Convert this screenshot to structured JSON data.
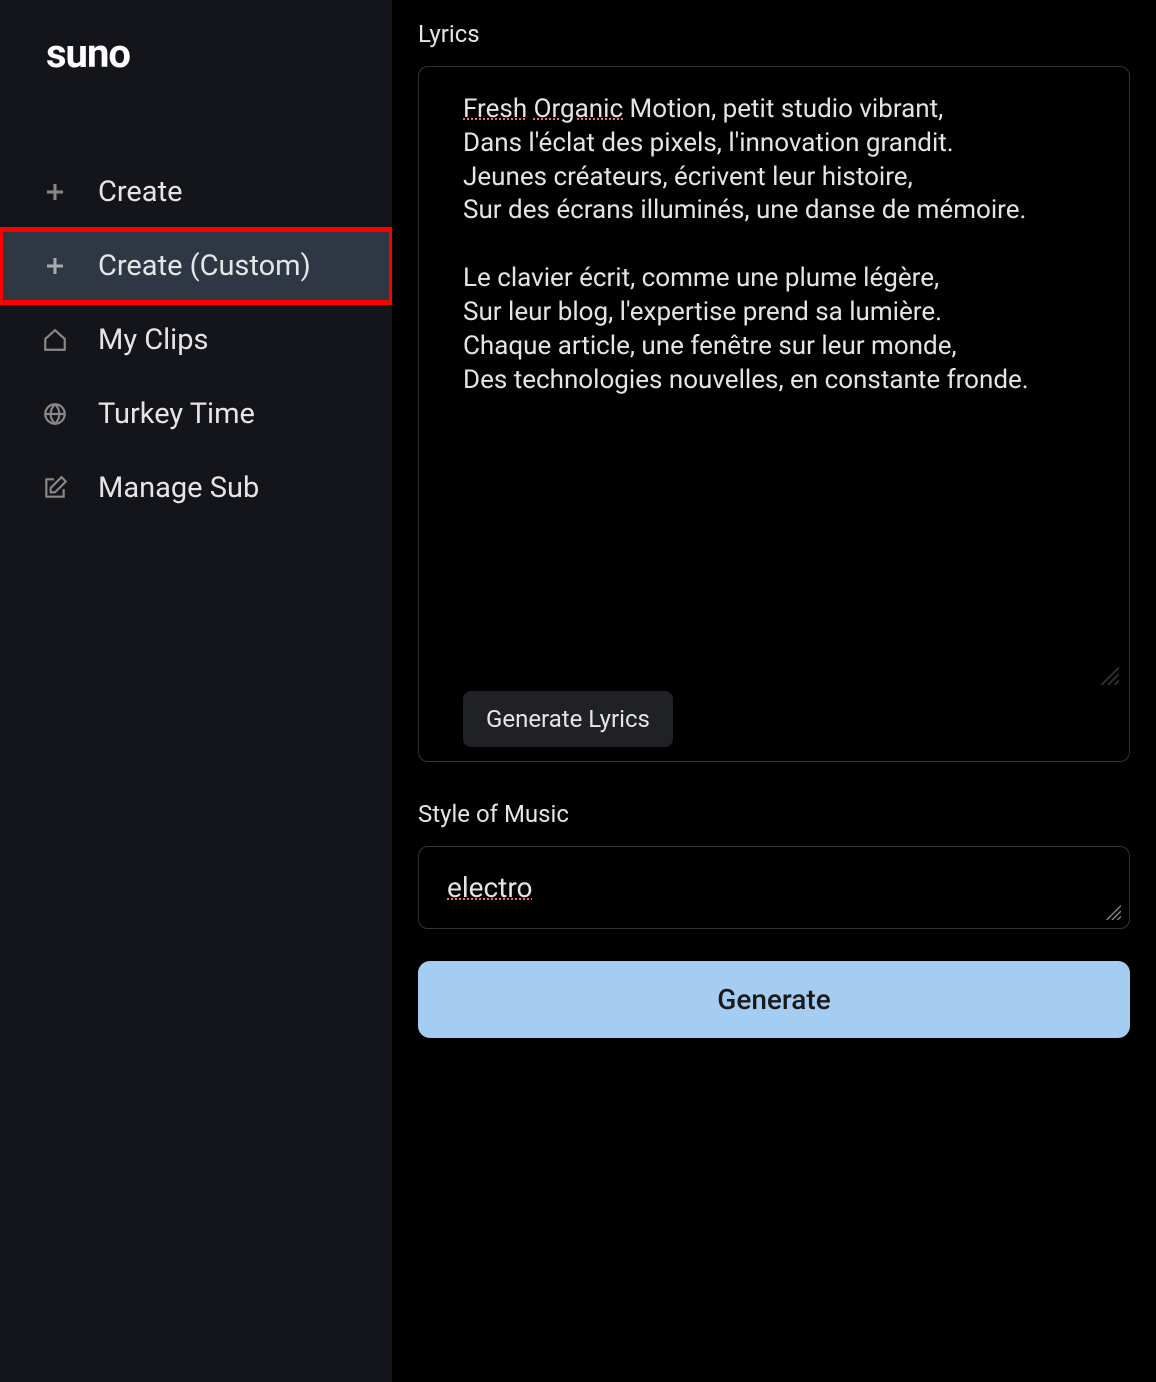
{
  "logo": "suno",
  "sidebar": {
    "items": [
      {
        "label": "Create",
        "icon": "plus",
        "active": false,
        "highlighted": false
      },
      {
        "label": "Create (Custom)",
        "icon": "plus",
        "active": true,
        "highlighted": true
      },
      {
        "label": "My Clips",
        "icon": "home",
        "active": false,
        "highlighted": false
      },
      {
        "label": "Turkey Time",
        "icon": "globe",
        "active": false,
        "highlighted": false
      },
      {
        "label": "Manage Sub",
        "icon": "edit",
        "active": false,
        "highlighted": false
      }
    ]
  },
  "lyrics": {
    "label": "Lyrics",
    "content_para1": "Fresh Organic Motion, petit studio vibrant,\nDans l'éclat des pixels, l'innovation grandit.\nJeunes créateurs, écrivent leur histoire,\nSur des écrans illuminés, une danse de mémoire.",
    "content_para2": "Le clavier écrit, comme une plume légère,\nSur leur blog, l'expertise prend sa lumière.\nChaque article, une fenêtre sur leur monde,\nDes technologies nouvelles, en constante fronde.",
    "spell_words": [
      "Fresh",
      "Organic"
    ],
    "generate_button": "Generate Lyrics"
  },
  "style": {
    "label": "Style of Music",
    "value": "electro",
    "spell": true
  },
  "generate_button": "Generate"
}
